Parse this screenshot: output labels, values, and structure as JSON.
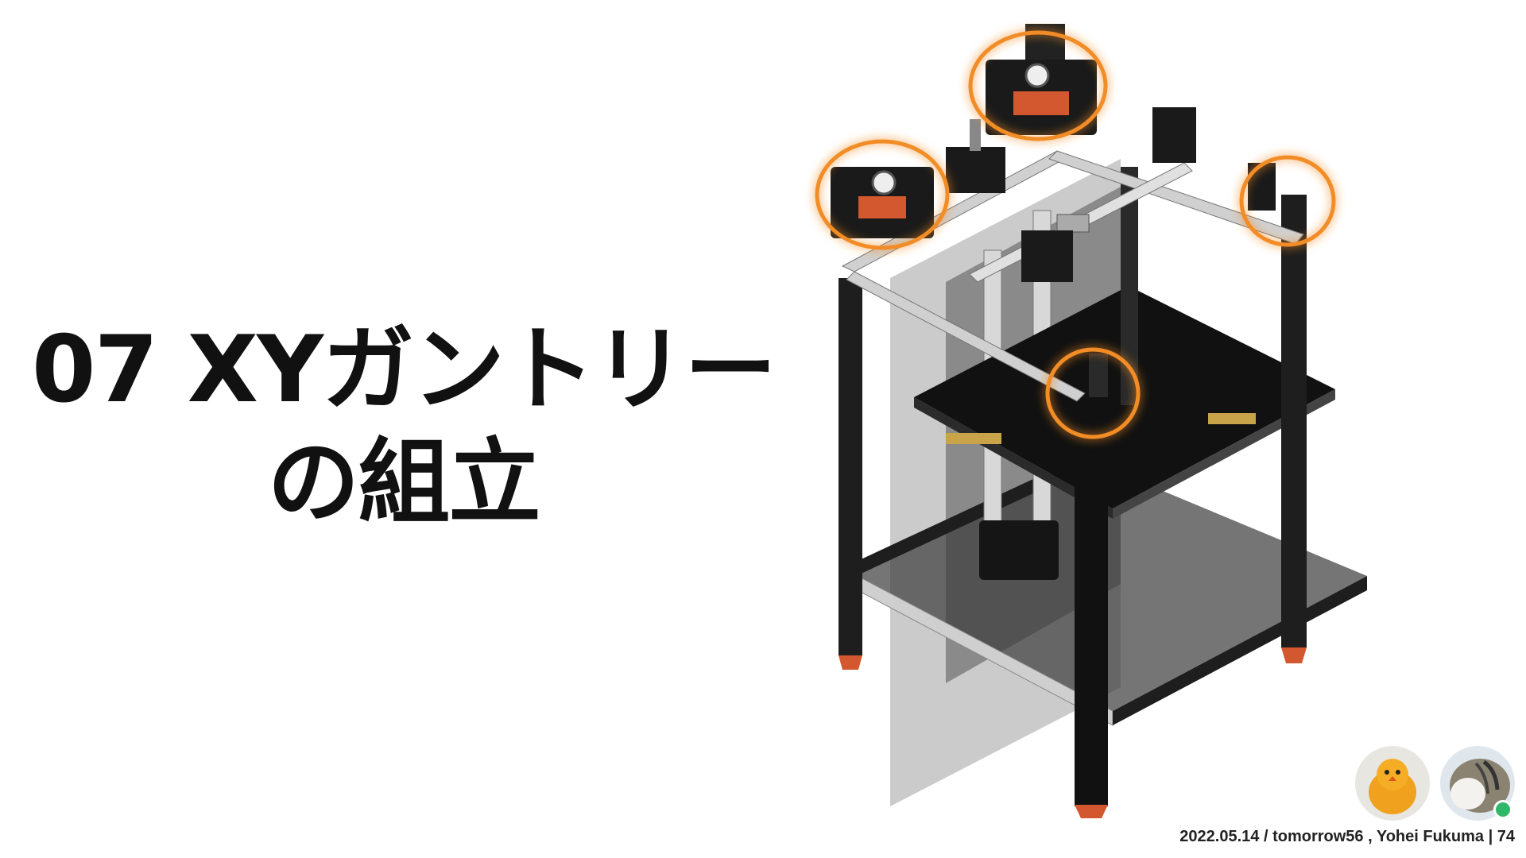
{
  "slide": {
    "title_line1": "07 XYガントリー",
    "title_line2": "の組立",
    "footer": "2022.05.14 / tomorrow56 , Yohei Fukuma | 74"
  },
  "illustration": {
    "highlight_color": "#f28c28",
    "frame_color": "#1e1e1e",
    "rail_color": "#c9c9c9",
    "accent_color": "#d4582f"
  },
  "presenters": {
    "avatar_1_icon": "chick-avatar-icon",
    "avatar_2_icon": "cat-avatar-icon",
    "status_color": "#2fb86a"
  }
}
